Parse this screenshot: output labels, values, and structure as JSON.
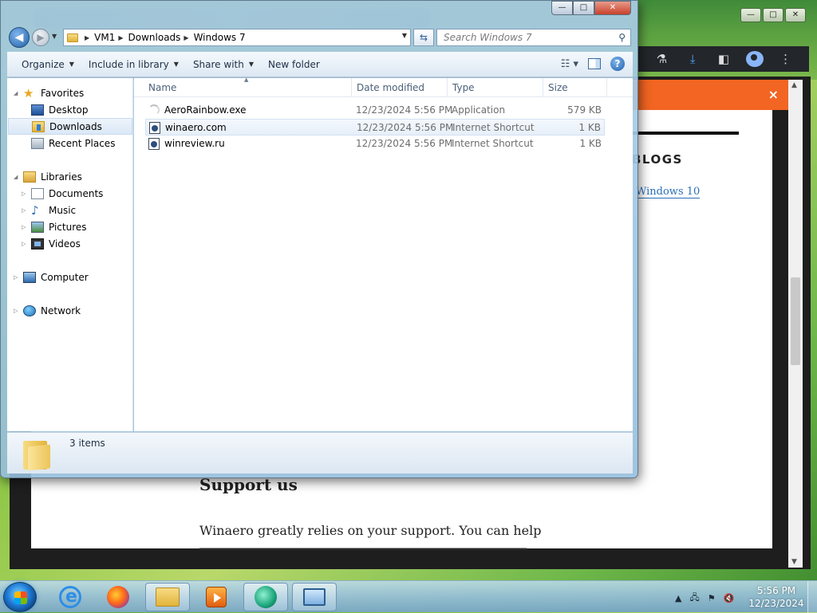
{
  "browser": {
    "caption": {
      "minimize": "—",
      "maximize": "□",
      "close": "✕"
    },
    "banner_close": "×",
    "blogs_heading": "BLOGS",
    "win10_link": "Windows 10",
    "support_heading": "Support us",
    "support_text": "Winaero greatly relies on your support. You can help"
  },
  "explorer": {
    "caption": {
      "minimize": "—",
      "maximize": "□",
      "close": "✕"
    },
    "address": {
      "crumbs": [
        "VM1",
        "Downloads",
        "Windows 7"
      ]
    },
    "search": {
      "placeholder": "Search Windows 7"
    },
    "commands": {
      "organize": "Organize",
      "include_in_library": "Include in library",
      "share_with": "Share with",
      "new_folder": "New folder"
    },
    "nav": {
      "favorites": "Favorites",
      "desktop": "Desktop",
      "downloads": "Downloads",
      "recent_places": "Recent Places",
      "libraries": "Libraries",
      "documents": "Documents",
      "music": "Music",
      "pictures": "Pictures",
      "videos": "Videos",
      "computer": "Computer",
      "network": "Network"
    },
    "columns": {
      "name": "Name",
      "date_modified": "Date modified",
      "type": "Type",
      "size": "Size"
    },
    "files": [
      {
        "name": "AeroRainbow.exe",
        "date": "12/23/2024 5:56 PM",
        "type": "Application",
        "size": "579 KB",
        "icon": "exe-icon"
      },
      {
        "name": "winaero.com",
        "date": "12/23/2024 5:56 PM",
        "type": "Internet Shortcut",
        "size": "1 KB",
        "icon": "url-icon"
      },
      {
        "name": "winreview.ru",
        "date": "12/23/2024 5:56 PM",
        "type": "Internet Shortcut",
        "size": "1 KB",
        "icon": "url-icon"
      }
    ],
    "details": {
      "items_count": "3 items"
    }
  },
  "taskbar": {
    "clock_time": "5:56 PM",
    "clock_date": "12/23/2024"
  }
}
